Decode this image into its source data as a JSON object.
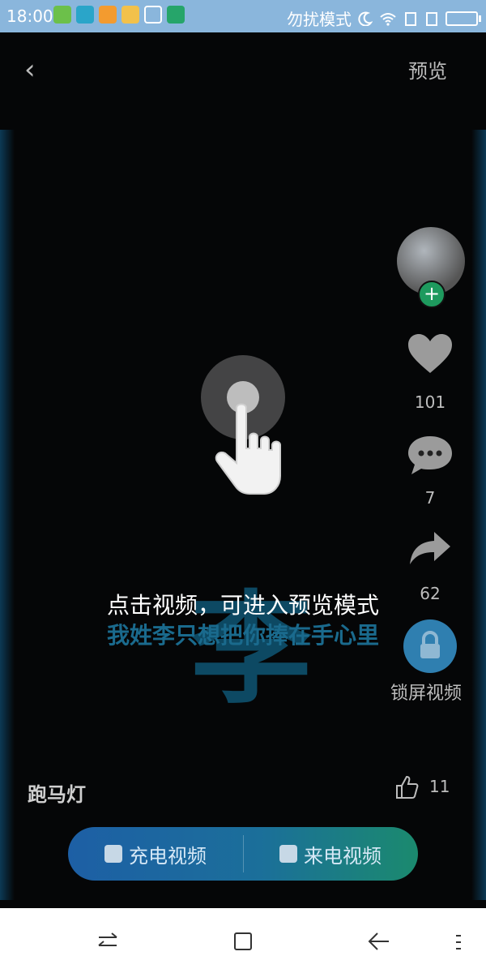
{
  "status_bar": {
    "time": "18:00",
    "mode": "勿扰模式"
  },
  "top_bar": {
    "back_label": "‹",
    "preview_label": "预览"
  },
  "rail": {
    "likes": "101",
    "comments": "7",
    "shares": "62",
    "lock_label": "锁屏视频"
  },
  "overlay": {
    "hint_text": "点击视频，可进入预览模式",
    "lyric": "我姓李只想把你捧在手心里",
    "big_char": "李"
  },
  "music": {
    "title": "跑马灯",
    "like_count": "11"
  },
  "buttons": {
    "charge_video": "充电视频",
    "incoming_video": "来电视频"
  },
  "colors": {
    "status_bar": "#8ab6dc",
    "pill_left": "#1d5fa5",
    "pill_right": "#1b8a6e",
    "lock": "#2f7fb0"
  }
}
